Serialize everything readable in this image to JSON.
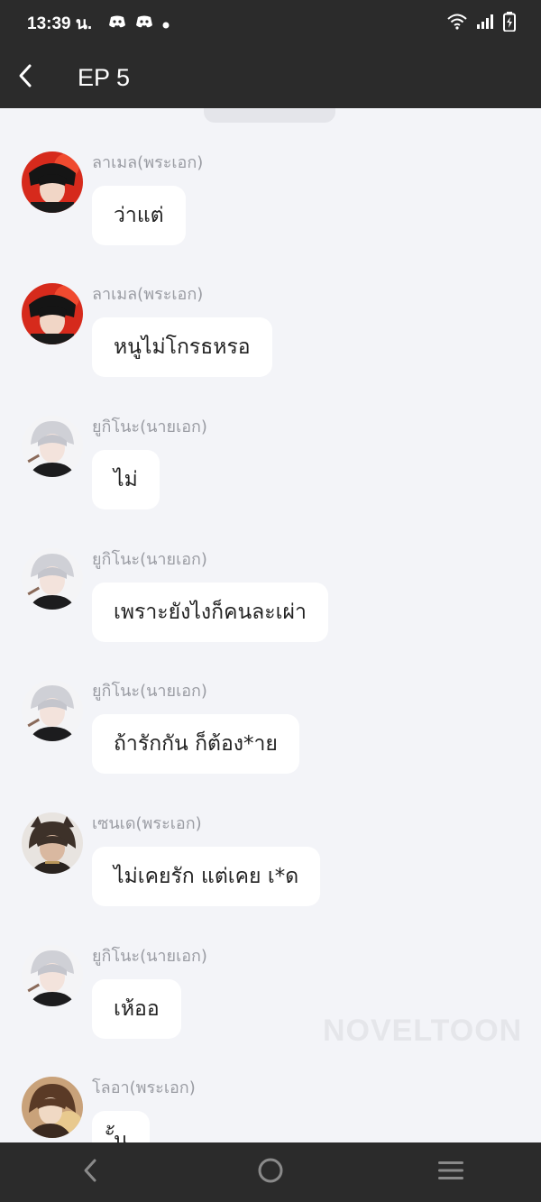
{
  "status_bar": {
    "time": "13:39 น.",
    "notification_icons": [
      "discord-icon",
      "discord-icon",
      "dot-icon"
    ],
    "system_icons": [
      "wifi-icon",
      "signal-icon",
      "battery-charging-icon"
    ]
  },
  "app_bar": {
    "title": "EP 5"
  },
  "watermark": "NOVELTOON",
  "messages": [
    {
      "sender": "ลาเมล(พระเอก)",
      "text": "ว่าแต่",
      "avatar": "red"
    },
    {
      "sender": "ลาเมล(พระเอก)",
      "text": "หนูไม่โกรธหรอ",
      "avatar": "red"
    },
    {
      "sender": "ยูกิโนะ(นายเอก)",
      "text": "ไม่",
      "avatar": "white"
    },
    {
      "sender": "ยูกิโนะ(นายเอก)",
      "text": "เพราะยังไงก็คนละเผ่า",
      "avatar": "white"
    },
    {
      "sender": "ยูกิโนะ(นายเอก)",
      "text": "ถ้ารักกัน ก็ต้อง*าย",
      "avatar": "white"
    },
    {
      "sender": "เซนเด(พระเอก)",
      "text": "ไม่เคยรัก แต่เคย เ*ด",
      "avatar": "brown"
    },
    {
      "sender": "ยูกิโนะ(นายเอก)",
      "text": "เห้ออ",
      "avatar": "white"
    },
    {
      "sender": "โลอา(พระเอก)",
      "text": "ั้น",
      "avatar": "gold"
    }
  ],
  "colors": {
    "bar_background": "#2b2b2b",
    "chat_background": "#f3f4f8",
    "bubble": "#ffffff",
    "sender_text": "#9a9ca3"
  }
}
